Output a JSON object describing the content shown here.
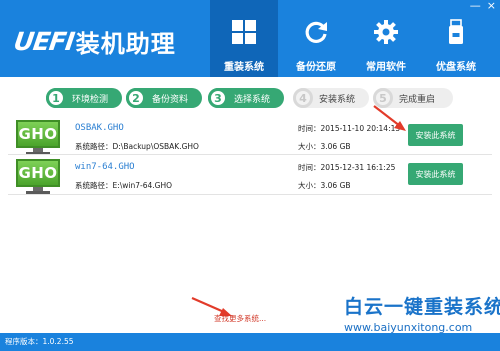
{
  "app": {
    "logo_mark": "UEFI",
    "logo_text": "装机助理",
    "window_controls": {
      "minimize": "—",
      "close": "×"
    }
  },
  "nav": [
    {
      "label": "重装系统",
      "icon": "windows-icon",
      "active": true
    },
    {
      "label": "备份还原",
      "icon": "refresh-icon",
      "active": false
    },
    {
      "label": "常用软件",
      "icon": "gear-icon",
      "active": false
    },
    {
      "label": "优盘系统",
      "icon": "usb-icon",
      "active": false
    }
  ],
  "steps": [
    {
      "num": "1",
      "label": "环境检测",
      "done": true
    },
    {
      "num": "2",
      "label": "备份资料",
      "done": true
    },
    {
      "num": "3",
      "label": "选择系统",
      "done": true
    },
    {
      "num": "4",
      "label": "安装系统",
      "done": false
    },
    {
      "num": "5",
      "label": "完成重启",
      "done": false
    }
  ],
  "systems": [
    {
      "badge": "GHO",
      "name": "OSBAK.GHO",
      "path": "系统路径：D:\\Backup\\OSBAK.GHO",
      "time": "时间：2015-11-10 20:14:15",
      "size": "大小：3.06 GB",
      "button": "安装此系统"
    },
    {
      "badge": "GHO",
      "name": "win7-64.GHO",
      "path": "系统路径：E:\\win7-64.GHO",
      "time": "时间：2015-12-31 16:1:25",
      "size": "大小：3.06 GB",
      "button": "安装此系统"
    }
  ],
  "search_more": "查找更多系统...",
  "watermark": {
    "title": "白云一键重装系统",
    "url": "www.baiyunxitong.com"
  },
  "footer": {
    "version": "程序版本：1.0.2.55"
  },
  "colors": {
    "header_blue": "#1a82dd",
    "active_tab": "#0f66b8",
    "accent_green": "#36a874",
    "link_blue": "#2b7fd2",
    "arrow_red": "#e23b2a"
  }
}
